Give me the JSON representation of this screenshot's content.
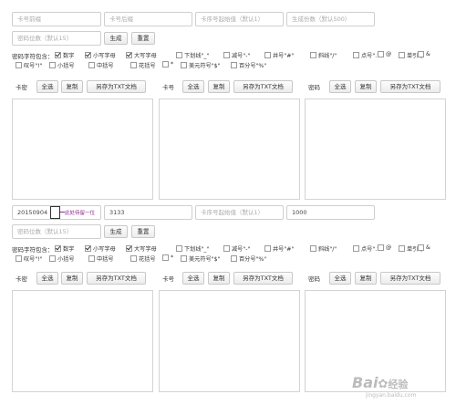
{
  "top": {
    "prefix_ph": "卡号前缀",
    "suffix_ph": "卡号后缀",
    "start_ph": "卡序号起始值（默认1）",
    "count_ph": "生成份数（默认500）",
    "pwdlen_ph": "密码位数（默认15）",
    "generate": "生成",
    "reset": "重置",
    "charset_label": "密码字符包含：",
    "opts": [
      {
        "label": "数字",
        "checked": true
      },
      {
        "label": "小写字母",
        "checked": true
      },
      {
        "label": "大写字母",
        "checked": true
      },
      {
        "label": "下划线\"_\"",
        "checked": false
      },
      {
        "label": "减号\"-\"",
        "checked": false
      },
      {
        "label": "井号\"#\"",
        "checked": false
      },
      {
        "label": "斜线\"/\"",
        "checked": false
      },
      {
        "label": "点号\".\"",
        "checked": false
      },
      {
        "label": "@",
        "checked": false
      },
      {
        "label": "单引号",
        "checked": false
      },
      {
        "label": "&",
        "checked": false
      },
      {
        "label": "叹号\"!\"",
        "checked": false
      },
      {
        "label": "小括号",
        "checked": false
      },
      {
        "label": "中括号",
        "checked": false
      },
      {
        "label": "花括号",
        "checked": false
      },
      {
        "label": "*",
        "checked": false
      },
      {
        "label": "美元符号\"$\"",
        "checked": false
      },
      {
        "label": "百分号\"%\"",
        "checked": false
      }
    ],
    "col1_label": "卡密",
    "col2_label": "卡号",
    "col3_label": "密码",
    "select_all": "全选",
    "copy": "复制",
    "save_txt": "另存为TXT文档"
  },
  "bottom": {
    "prefix_value": "20150904",
    "annotation": "此处待留一位",
    "suffix_value": "3133",
    "start_ph": "卡序号起始值（默认1）",
    "count_value": "1000",
    "pwdlen_ph": "密码位数（默认15）",
    "generate": "生成",
    "reset": "重置",
    "charset_label": "密码字符包含：",
    "col1_label": "卡密",
    "col2_label": "卡号",
    "col3_label": "密码",
    "select_all": "全选",
    "copy": "复制",
    "save_txt": "另存为TXT文档"
  },
  "watermark": {
    "brand": "Bai",
    "brand2": "经验",
    "url": "jingyan.baidu.com"
  }
}
